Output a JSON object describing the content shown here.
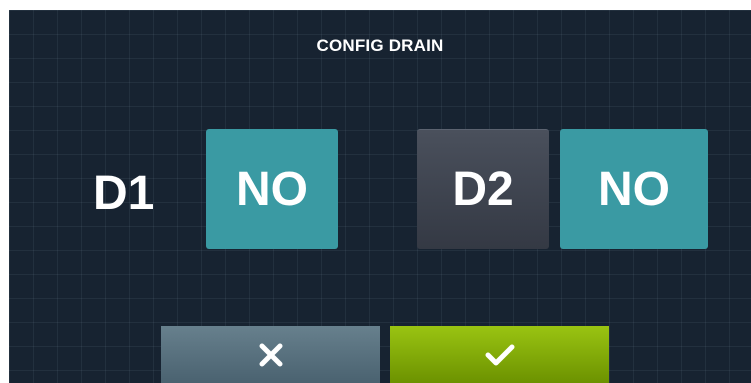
{
  "screen": {
    "title": "CONFIG DRAIN",
    "background_color": "#172331"
  },
  "drains": [
    {
      "label": "D1",
      "value": "NO",
      "label_style": "plain"
    },
    {
      "label": "D2",
      "value": "NO",
      "label_style": "button"
    }
  ],
  "actions": {
    "cancel_icon": "close-icon",
    "confirm_icon": "check-icon"
  },
  "colors": {
    "value_tile": "#3a9aa3",
    "d2_tile": "#3c424d",
    "cancel_button": "#5a7280",
    "confirm_button": "#84ad08"
  }
}
